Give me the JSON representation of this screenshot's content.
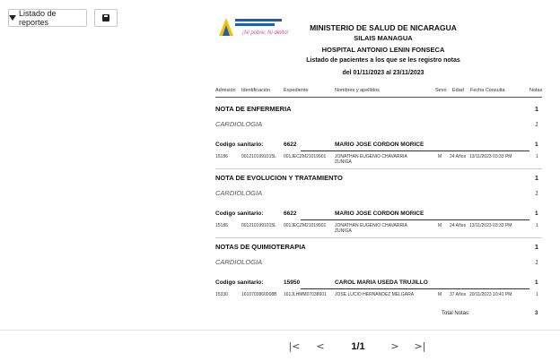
{
  "toolbar": {
    "reports_label": "Listado de reportes"
  },
  "report": {
    "logo_text": "Ministerio de Salud",
    "logo_tagline": "¡Ni pobre, Ni delito!",
    "ministry": "MINISTERIO DE SALUD DE NICARAGUA",
    "silais": "SILAIS MANAGUA",
    "hospital": "HOSPITAL ANTONIO LENIN FONSECA",
    "subtitle": "Listado de pacientes a los que se les registro notas",
    "period": "del 01/11/2023 al 23/11/2023",
    "columns": {
      "admision": "Admisión",
      "identificacion": "Identificación",
      "expediente": "Expediente",
      "nombres": "Nombres y apellidos",
      "sexo": "Sexo",
      "edad": "Edad",
      "fecha": "Fecha Consulta",
      "notas": "Notas"
    },
    "code_label": "Codigo sanitario:",
    "sections": [
      {
        "title": "NOTA DE ENFERMERIA",
        "count": "1",
        "sub": "CARDIOLOGIA",
        "sub_count": "1",
        "code": "6622",
        "doctor": "MARIO JOSE CORDON MORICE",
        "code_count": "1",
        "row": {
          "admision": "15186",
          "identificacion": "0012101991015L",
          "expediente": "001JECZM21019901",
          "nombre": "JONATHAN EUGENIO CHAVARRIA ZUNIGA",
          "sexo": "M",
          "edad": "24 Años",
          "fecha": "13/11/2023 03:33 PM",
          "notas": "1"
        }
      },
      {
        "title": "NOTA DE EVOLUCION Y TRATAMIENTO",
        "count": "1",
        "sub": "CARDIOLOGIA",
        "sub_count": "1",
        "code": "6622",
        "doctor": "MARIO JOSE CORDON MORICE",
        "code_count": "1",
        "row": {
          "admision": "15186",
          "identificacion": "0012101991015L",
          "expediente": "001JECZM21019901",
          "nombre": "JONATHAN EUGENIO CHAVARRIA ZUNIGA",
          "sexo": "M",
          "edad": "24 Años",
          "fecha": "13/11/2023 03:33 PM",
          "notas": "1"
        }
      },
      {
        "title": "NOTAS DE QUIMIOTERAPIA",
        "count": "1",
        "sub": "CARDIOLOGIA",
        "sub_count": "1",
        "code": "15950",
        "doctor": "CAROL MARIA USEDA TRUJILLO",
        "code_count": "1",
        "row": {
          "admision": "15330",
          "identificacion": "1610703860008B",
          "expediente": "161JLHMM07038601",
          "nombre": "JOSE LUCIO HERNANDEZ MELGARA",
          "sexo": "M",
          "edad": "37 Años",
          "fecha": "20/11/2023 10:41 PM",
          "notas": "1"
        }
      }
    ],
    "total_label": "Total Notas:",
    "total_value": "3"
  },
  "pager": {
    "first": "|<",
    "prev": "<",
    "page": "1/1",
    "next": ">",
    "last": ">|"
  }
}
